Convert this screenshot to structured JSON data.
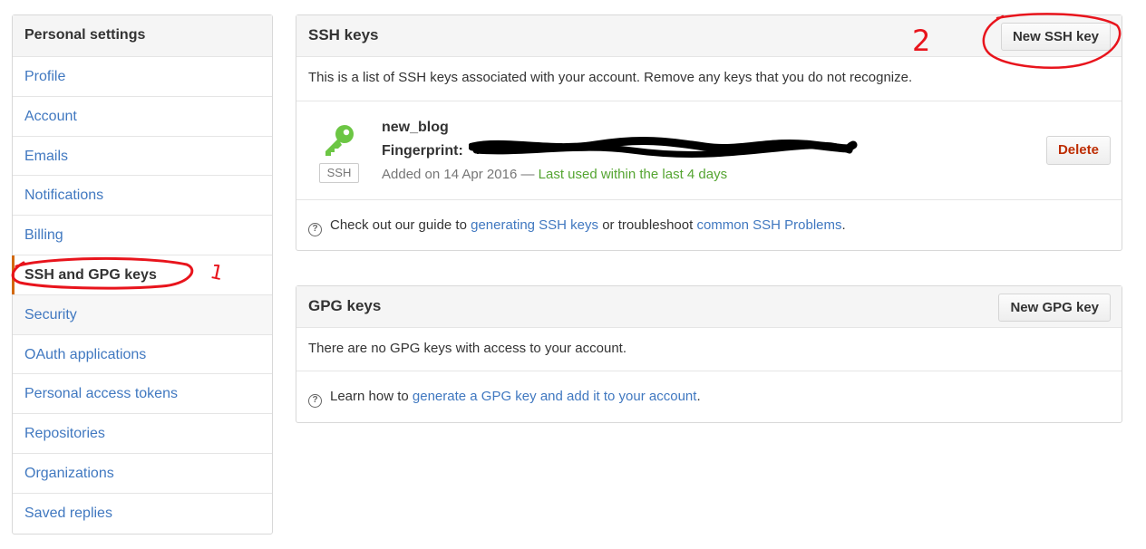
{
  "sidebar": {
    "header": "Personal settings",
    "items": [
      {
        "label": "Profile"
      },
      {
        "label": "Account"
      },
      {
        "label": "Emails"
      },
      {
        "label": "Notifications"
      },
      {
        "label": "Billing"
      },
      {
        "label": "SSH and GPG keys"
      },
      {
        "label": "Security"
      },
      {
        "label": "OAuth applications"
      },
      {
        "label": "Personal access tokens"
      },
      {
        "label": "Repositories"
      },
      {
        "label": "Organizations"
      },
      {
        "label": "Saved replies"
      }
    ],
    "selected_label": "SSH and GPG keys"
  },
  "ssh": {
    "title": "SSH keys",
    "new_button": "New SSH key",
    "description": "This is a list of SSH keys associated with your account. Remove any keys that you do not recognize.",
    "key": {
      "name": "new_blog",
      "fingerprint_label": "Fingerprint:",
      "badge": "SSH",
      "added": "Added on 14 Apr 2016 —",
      "last_used": "Last used within the last 4 days",
      "delete_button": "Delete"
    },
    "help_prefix": "Check out our guide to",
    "help_link1": "generating SSH keys",
    "help_middle": "or troubleshoot",
    "help_link2": "common SSH Problems",
    "help_suffix": "."
  },
  "gpg": {
    "title": "GPG keys",
    "new_button": "New GPG key",
    "empty": "There are no GPG keys with access to your account.",
    "help_prefix": "Learn how to",
    "help_link": "generate a GPG key and add it to your account",
    "help_suffix": "."
  },
  "annotations": {
    "step1": "1",
    "step2": "2"
  },
  "colors": {
    "link": "#4078c0",
    "accent": "#d26911",
    "success": "#55a532",
    "danger": "#bd2c00",
    "annotation": "#e8141c"
  }
}
